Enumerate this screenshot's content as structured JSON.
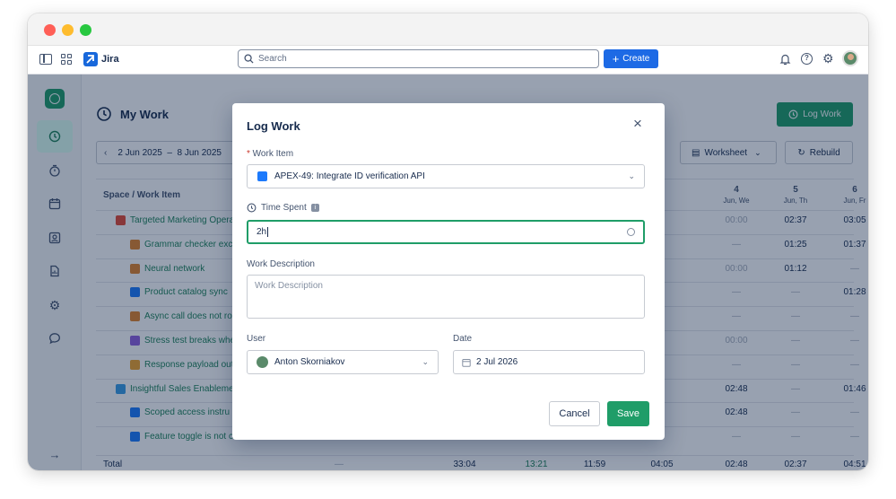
{
  "topnav": {
    "app_name": "Jira",
    "search_placeholder": "Search",
    "create_label": "Create"
  },
  "page": {
    "title": "My Work",
    "log_work_label": "Log Work",
    "date_range": "2 Jun 2025  –  8 Jun 2025",
    "worksheet_label": "Worksheet",
    "rebuild_label": "Rebuild"
  },
  "table": {
    "header_label": "Space / Work Item",
    "visible_days": [
      {
        "num": "4",
        "day": "Jun, We"
      },
      {
        "num": "5",
        "day": "Jun, Th"
      },
      {
        "num": "6",
        "day": "Jun, Fr"
      }
    ],
    "rows": [
      {
        "label": "Targeted Marketing Opera",
        "kind": "space",
        "c4": "00:00",
        "c5": "02:37",
        "c6": "03:05"
      },
      {
        "label": "Grammar checker exc",
        "kind": "question",
        "c4": "—",
        "c5": "01:25",
        "c6": "01:37"
      },
      {
        "label": "Neural network",
        "kind": "question",
        "c4": "00:00",
        "c5": "01:12",
        "c6": "—"
      },
      {
        "label": "Product catalog sync",
        "kind": "check",
        "c4": "—",
        "c5": "—",
        "c6": "01:28"
      },
      {
        "label": "Async call does not ro",
        "kind": "question",
        "c4": "—",
        "c5": "—",
        "c6": "—"
      },
      {
        "label": "Stress test breaks whe",
        "kind": "purple",
        "c4": "00:00",
        "c5": "—",
        "c6": "—"
      },
      {
        "label": "Response payload out",
        "kind": "mail",
        "c4": "—",
        "c5": "—",
        "c6": "—"
      },
      {
        "label": "Insightful Sales Enableme",
        "kind": "space2",
        "c4": "02:48",
        "c5": "—",
        "c6": "01:46"
      },
      {
        "label": "Scoped access instru",
        "kind": "checkblue",
        "c4": "02:48",
        "c5": "—",
        "c6": "—"
      },
      {
        "label": "Feature toggle is not c",
        "kind": "checkblue",
        "c4": "—",
        "c5": "—",
        "c6": "—"
      }
    ],
    "total_label": "Total",
    "totals": [
      "—",
      "33:04",
      "13:21",
      "11:59",
      "04:05",
      "02:48",
      "02:37",
      "04:51"
    ]
  },
  "modal": {
    "title": "Log Work",
    "work_item_label": "Work Item",
    "work_item_value": "APEX-49: Integrate ID verification API",
    "time_spent_label": "Time Spent",
    "time_spent_value": "2h",
    "description_label": "Work Description",
    "description_placeholder": "Work Description",
    "user_label": "User",
    "user_value": "Anton Skorniakov",
    "date_label": "Date",
    "date_value": "2 Jul 2026",
    "cancel_label": "Cancel",
    "save_label": "Save"
  },
  "colors": {
    "accent_blue": "#1d6ae5",
    "accent_green": "#1f9d68",
    "link_green": "#1f845a"
  }
}
